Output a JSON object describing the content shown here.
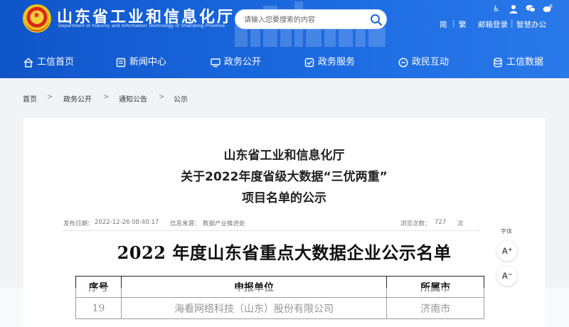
{
  "header": {
    "title": "山东省工业和信息化厅",
    "subtitle": "Department of Industry and Information Technology of Shandong Province",
    "search_placeholder": "请输入您要搜索的内容",
    "top_links": [
      "简",
      "繁",
      "邮箱登录",
      "智慧办公"
    ],
    "top_icons": [
      "accessibility-icon",
      "user-icon",
      "wechat-icon",
      "weibo-icon"
    ]
  },
  "nav": {
    "items": [
      {
        "label": "工信首页",
        "icon": "home-icon"
      },
      {
        "label": "新闻中心",
        "icon": "news-icon"
      },
      {
        "label": "政务公开",
        "icon": "monitor-icon"
      },
      {
        "label": "政务服务",
        "icon": "service-icon"
      },
      {
        "label": "政民互动",
        "icon": "interaction-icon"
      },
      {
        "label": "工信数据",
        "icon": "database-icon"
      }
    ]
  },
  "breadcrumb": [
    "首页",
    "政务公开",
    "通知公告",
    "公示"
  ],
  "article": {
    "title_lines": [
      "山东省工业和信息化厅",
      "关于2022年度省级大数据“三优两重”",
      "项目名单的公示"
    ],
    "publish_label": "发布日期：",
    "publish_date": "2022-12-26 08:40:17",
    "source_label": "信息来源：",
    "source": "数据产业推进处",
    "views_label": "浏览次数：",
    "views": "727",
    "views_unit": "次",
    "doc_title": "2022 年度山东省重点大数据企业公示名单",
    "table": {
      "headers": [
        "序号",
        "申报单位",
        "所属市"
      ],
      "rows": [
        [
          "19",
          "海看网络科技（山东）股份有限公司",
          "济南市"
        ]
      ]
    }
  },
  "font_tool": {
    "label": "字体",
    "increase": "A⁺",
    "decrease": "A⁻"
  },
  "colors": {
    "header_blue": "#1c6ae0",
    "page_bg": "#f1f3f6"
  }
}
